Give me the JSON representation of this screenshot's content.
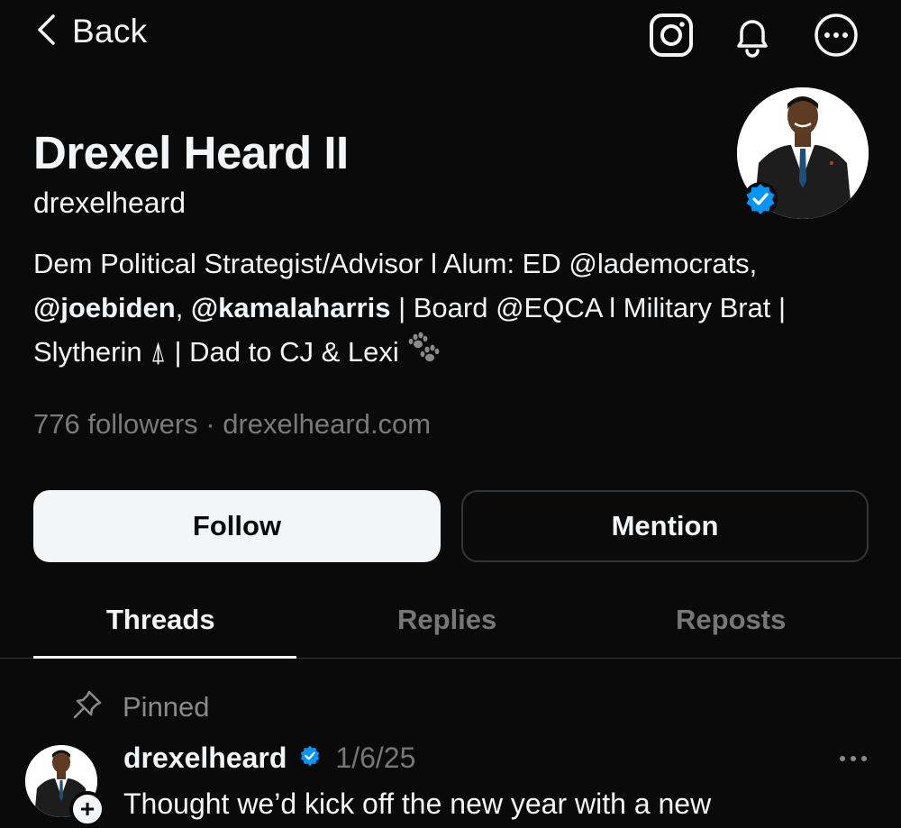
{
  "header": {
    "back_label": "Back",
    "icons": [
      "instagram-icon",
      "bell-icon",
      "more-options-icon"
    ]
  },
  "profile": {
    "display_name": "Drexel Heard II",
    "username": "drexelheard",
    "verified": true,
    "bio": {
      "line1": "Dem Political Strategist/Advisor l Alum: ED @lademocrats,",
      "mention1": "@joebiden",
      "sep": ", ",
      "mention2": "@kamalaharris",
      "line2_rest": " | Board @EQCA l Military Brat |",
      "line3_text": "Slytherin ",
      "line3_symbol": "⍋",
      "line3_rest": " | Dad to CJ & Lexi ",
      "emoji": "paw-prints-icon"
    },
    "followers": "776 followers",
    "dot": " · ",
    "website": "drexelheard.com"
  },
  "actions": {
    "follow_label": "Follow",
    "mention_label": "Mention"
  },
  "tabs": [
    {
      "label": "Threads",
      "active": true
    },
    {
      "label": "Replies",
      "active": false
    },
    {
      "label": "Reposts",
      "active": false
    }
  ],
  "pinned_post": {
    "pinned_label": "Pinned",
    "username": "drexelheard",
    "date": "1/6/25",
    "text": "Thought we’d kick off the new year with a new",
    "plus": "+"
  },
  "colors": {
    "background": "#0a0a0a",
    "text": "#f3f5f7",
    "muted": "#777777",
    "verified": "#0095f6",
    "border": "#333638"
  }
}
